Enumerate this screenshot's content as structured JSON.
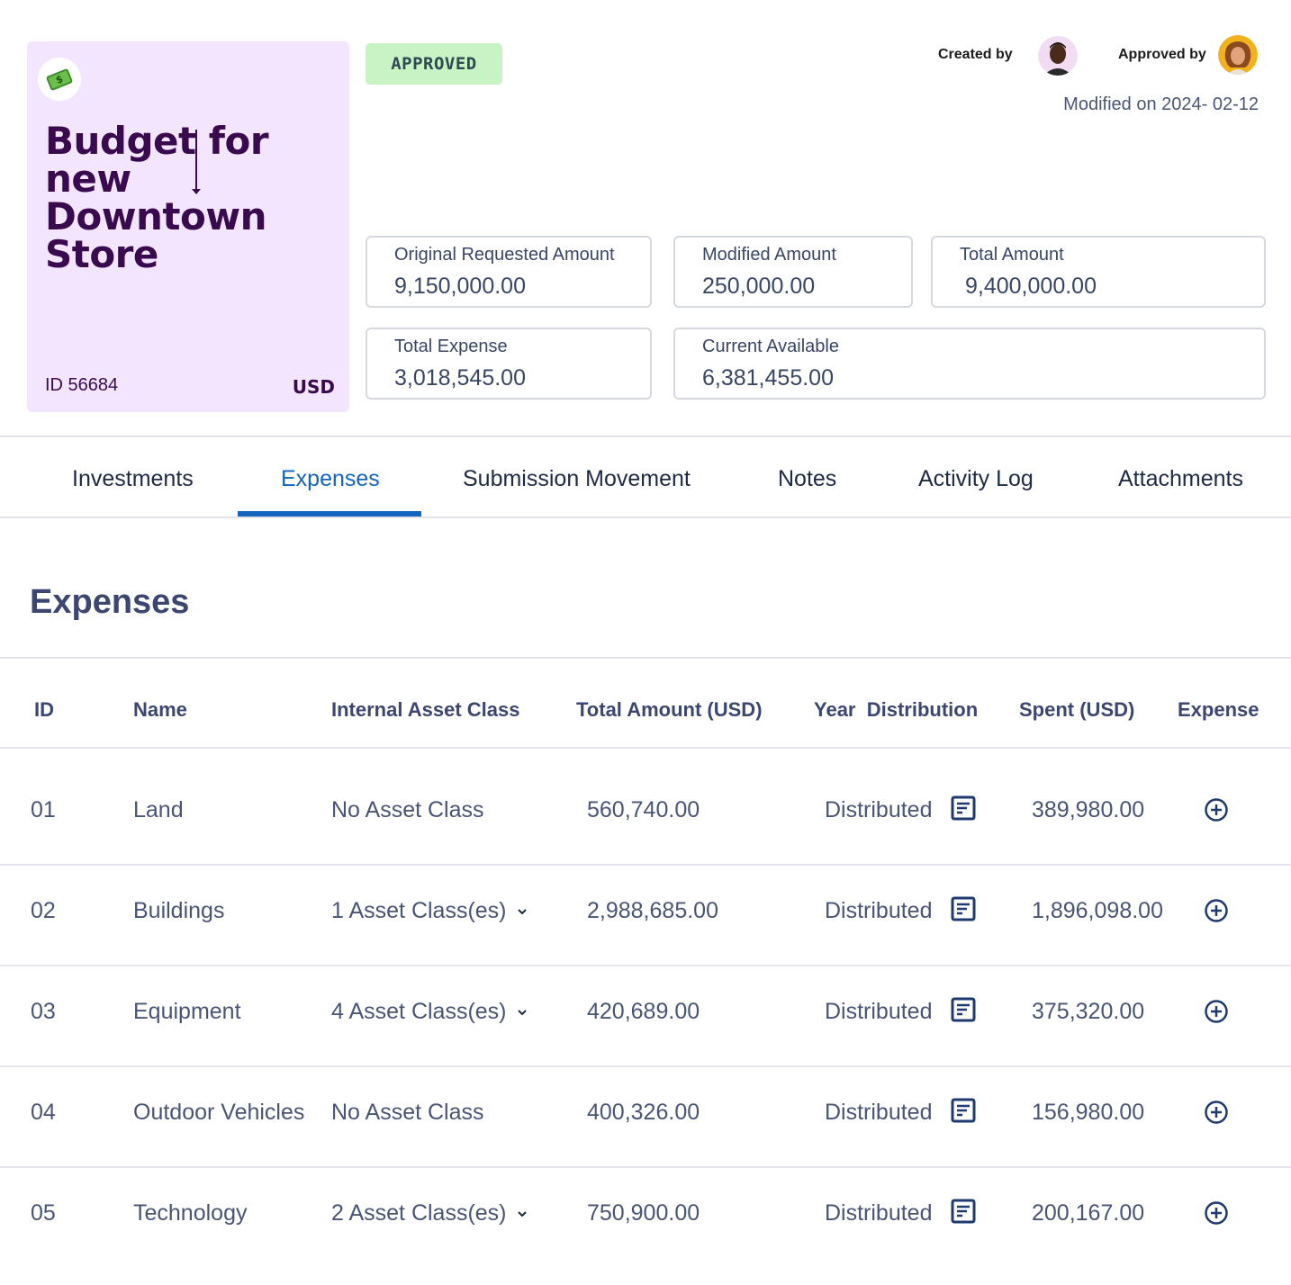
{
  "card": {
    "icon": "money-bill-icon",
    "title": "Budget for new Downtown Store",
    "id_label": "ID 56684",
    "currency": "USD"
  },
  "status": {
    "label": "APPROVED",
    "color": "#c7f3c5"
  },
  "meta": {
    "created_by_label": "Created by",
    "approved_by_label": "Approved by",
    "modified": "Modified on 2024- 02-12"
  },
  "stats": {
    "original_requested": {
      "label": "Original Requested Amount",
      "value": "9,150,000.00"
    },
    "modified_amount": {
      "label": "Modified Amount",
      "value": "250,000.00"
    },
    "total_amount": {
      "label": "Total Amount",
      "value": "9,400,000.00"
    },
    "total_expense": {
      "label": "Total Expense",
      "value": "3,018,545.00"
    },
    "current_available": {
      "label": "Current Available",
      "value": "6,381,455.00"
    }
  },
  "tabs": [
    {
      "label": "Investments",
      "active": false
    },
    {
      "label": "Expenses",
      "active": true
    },
    {
      "label": "Submission Movement",
      "active": false
    },
    {
      "label": "Notes",
      "active": false
    },
    {
      "label": "Activity Log",
      "active": false
    },
    {
      "label": "Attachments",
      "active": false
    }
  ],
  "accent_color": "#1565c0",
  "section_title": "Expenses",
  "table": {
    "headers": [
      "ID",
      "Name",
      "Internal Asset Class",
      "Total Amount (USD)",
      "Year  Distribution",
      "Spent (USD)",
      "Expense"
    ],
    "rows": [
      {
        "id": "01",
        "name": "Land",
        "asset_class": "No Asset Class",
        "has_dropdown": false,
        "total": "560,740.00",
        "distribution": "Distributed",
        "spent": "389,980.00"
      },
      {
        "id": "02",
        "name": "Buildings",
        "asset_class": "1 Asset Class(es)",
        "has_dropdown": true,
        "total": "2,988,685.00",
        "distribution": "Distributed",
        "spent": "1,896,098.00"
      },
      {
        "id": "03",
        "name": "Equipment",
        "asset_class": "4 Asset Class(es)",
        "has_dropdown": true,
        "total": "420,689.00",
        "distribution": "Distributed",
        "spent": "375,320.00"
      },
      {
        "id": "04",
        "name": "Outdoor Vehicles",
        "asset_class": "No Asset Class",
        "has_dropdown": false,
        "total": "400,326.00",
        "distribution": "Distributed",
        "spent": "156,980.00"
      },
      {
        "id": "05",
        "name": "Technology",
        "asset_class": "2 Asset Class(es)",
        "has_dropdown": true,
        "total": "750,900.00",
        "distribution": "Distributed",
        "spent": "200,167.00"
      }
    ]
  }
}
